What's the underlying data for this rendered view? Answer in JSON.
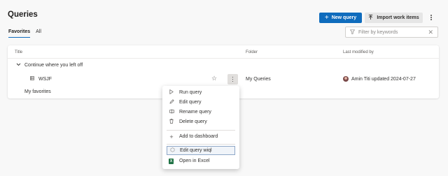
{
  "page_title": "Queries",
  "toolbar": {
    "new_query_label": "New query",
    "import_label": "Import work items"
  },
  "tabs": [
    {
      "label": "Favorites",
      "active": true
    },
    {
      "label": "All",
      "active": false
    }
  ],
  "filter": {
    "placeholder": "Filter by keywords"
  },
  "table": {
    "columns": [
      "Title",
      "Folder",
      "Last modified by"
    ],
    "group_label": "Continue where you left off",
    "row": {
      "title": "WSJF",
      "folder": "My Queries",
      "modified": "Amin Titi updated 2024-07-27"
    },
    "favorites_label": "My favorites"
  },
  "context_menu": {
    "items": [
      {
        "label": "Run query",
        "icon": "play-icon"
      },
      {
        "label": "Edit query",
        "icon": "pencil-icon"
      },
      {
        "label": "Rename query",
        "icon": "rename-icon"
      },
      {
        "label": "Delete query",
        "icon": "trash-icon"
      },
      {
        "label": "Add to dashboard",
        "icon": "plus-icon"
      },
      {
        "label": "Edit query wiql",
        "icon": "wiql-icon",
        "selected": true
      },
      {
        "label": "Open in Excel",
        "icon": "excel-icon"
      }
    ]
  },
  "colors": {
    "accent": "#0f6cbd",
    "background": "#f8f8f8",
    "excel_green": "#217346"
  }
}
